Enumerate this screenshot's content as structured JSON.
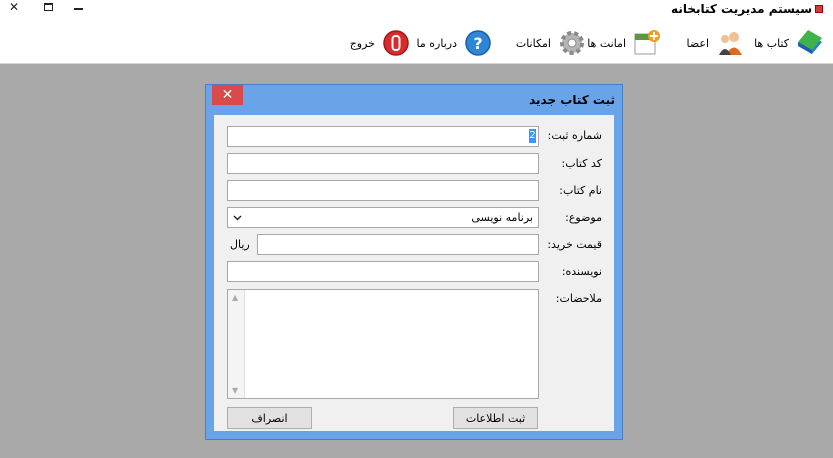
{
  "app": {
    "title": "سیستم مدیریت کتابخانه"
  },
  "window_controls": {
    "close": "✕"
  },
  "toolbar": {
    "books": "کتاب ها",
    "members": "اعضا",
    "loans": "امانت ها",
    "facilities": "امکانات",
    "about": "درباره ما",
    "exit": "خروج"
  },
  "dialog": {
    "title": "ثبت کتاب جدید",
    "close": "✕",
    "labels": {
      "reg_no": "شماره ثبت:",
      "book_code": "کد کتاب:",
      "book_name": "نام کتاب:",
      "subject": "موضوع:",
      "price": "قیمت خرید:",
      "author": "نویسنده:",
      "notes": "ملاحضات:"
    },
    "values": {
      "reg_no": "2",
      "subject": "برنامه نویسی",
      "currency": "ریال"
    },
    "buttons": {
      "submit": "ثبت اطلاعات",
      "cancel": "انصراف"
    }
  },
  "colors": {
    "dialog_frame": "#6aa4e8",
    "close_button": "#d94a4a",
    "background": "#a9a9a9"
  }
}
